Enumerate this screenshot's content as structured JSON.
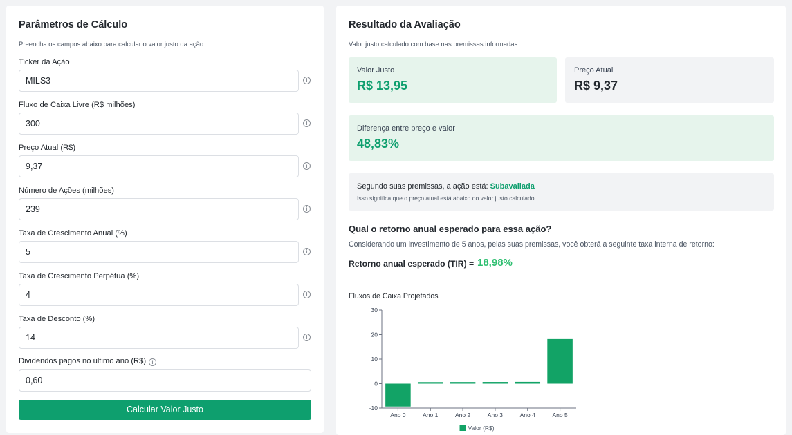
{
  "params": {
    "title": "Parâmetros de Cálculo",
    "subtitle": "Preencha os campos abaixo para calcular o valor justo da ação",
    "fields": [
      {
        "label": "Ticker da Ação",
        "value": "MILS3"
      },
      {
        "label": "Fluxo de Caixa Livre (R$ milhões)",
        "value": "300"
      },
      {
        "label": "Preço Atual (R$)",
        "value": "9,37"
      },
      {
        "label": "Número de Ações (milhões)",
        "value": "239"
      },
      {
        "label": "Taxa de Crescimento Anual (%)",
        "value": "5"
      },
      {
        "label": "Taxa de Crescimento Perpétua (%)",
        "value": "4"
      },
      {
        "label": "Taxa de Desconto (%)",
        "value": "14"
      },
      {
        "label": "Dividendos pagos no último ano (R$)",
        "value": "0,60"
      }
    ],
    "button_label": "Calcular Valor Justo",
    "info_icon_glyph": "i"
  },
  "result": {
    "title": "Resultado da Avaliação",
    "subtitle": "Valor justo calculado com base nas premissas informadas",
    "fair_value_label": "Valor Justo",
    "fair_value": "R$ 13,95",
    "current_price_label": "Preço Atual",
    "current_price": "R$ 9,37",
    "difference_label": "Diferença entre preço e valor",
    "difference": "48,83%",
    "verdict_prefix": "Segundo suas premissas, a ação está:",
    "verdict_status": "Subavaliada",
    "verdict_explanation": "Isso significa que o preço atual está abaixo do valor justo calculado.",
    "question_title": "Qual o retorno anual esperado para essa ação?",
    "question_text": "Considerando um investimento de 5 anos, pelas suas premissas, você obterá a seguinte taxa interna de retorno:",
    "tir_label": "Retorno anual esperado (TIR) =",
    "tir_value": "18,98%"
  },
  "colors": {
    "accent": "#0e9f6e",
    "bar": "#12a366",
    "tir": "#2fbf71"
  },
  "chart_data": {
    "type": "bar",
    "title": "Fluxos de Caixa Projetados",
    "categories": [
      "Ano 0",
      "Ano 1",
      "Ano 2",
      "Ano 3",
      "Ano 4",
      "Ano 5"
    ],
    "series": [
      {
        "name": "Valor (R$)",
        "values": [
          -9.37,
          0.63,
          0.66,
          0.69,
          0.73,
          18.2
        ]
      }
    ],
    "ylim": [
      -10,
      30
    ],
    "yticks": [
      -10,
      0,
      10,
      20,
      30
    ],
    "legend": "bottom"
  }
}
